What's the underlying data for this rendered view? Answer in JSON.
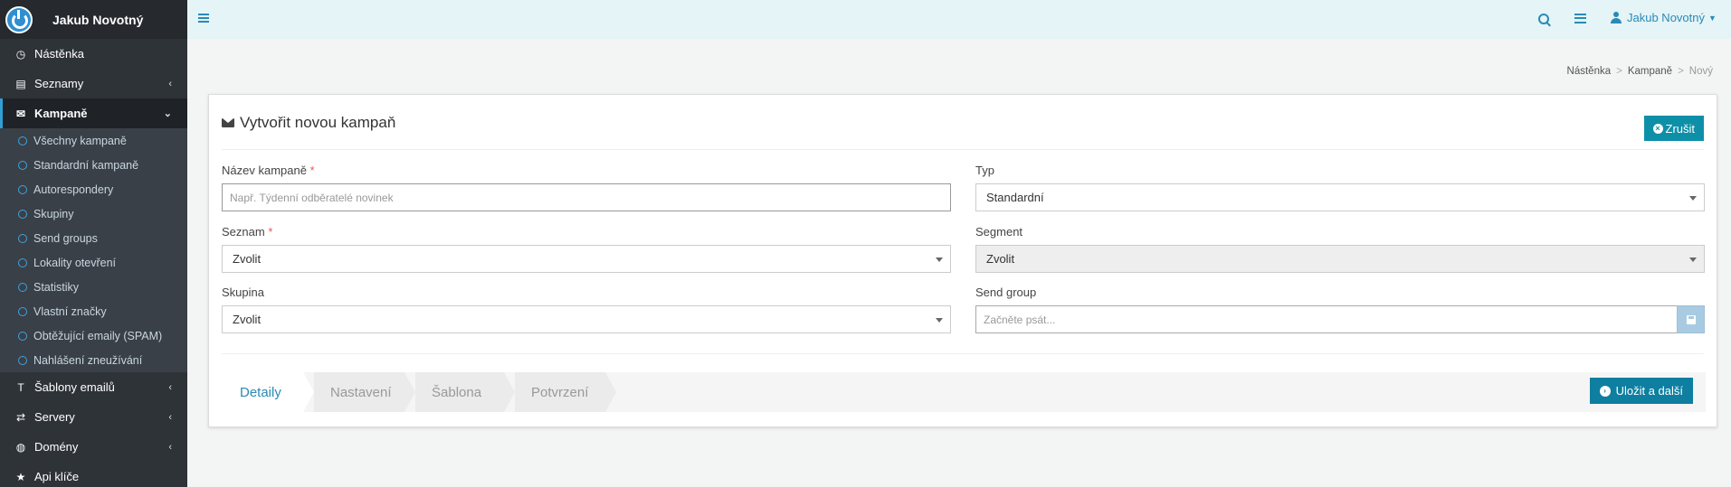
{
  "brand": {
    "name": "Jakub Novotný"
  },
  "sidebar": {
    "items": [
      {
        "label": "Nástěnka",
        "icon": "dashboard-icon"
      },
      {
        "label": "Seznamy",
        "icon": "list-icon"
      },
      {
        "label": "Kampaně",
        "icon": "envelope-icon"
      },
      {
        "label": "Šablony emailů",
        "icon": "text-icon"
      },
      {
        "label": "Servery",
        "icon": "exchange-icon"
      },
      {
        "label": "Domény",
        "icon": "globe-icon"
      },
      {
        "label": "Api klíče",
        "icon": "star-icon"
      }
    ],
    "sub_items": [
      "Všechny kampaně",
      "Standardní kampaně",
      "Autorespondery",
      "Skupiny",
      "Send groups",
      "Lokality otevření",
      "Statistiky",
      "Vlastní značky",
      "Obtěžující emaily (SPAM)",
      "Nahlášení zneužívání"
    ]
  },
  "topbar": {
    "user": "Jakub Novotný"
  },
  "breadcrumb": {
    "home": "Nástěnka",
    "section": "Kampaně",
    "current": "Nový"
  },
  "panel": {
    "title": "Vytvořit novou kampaň",
    "cancel_label": "Zrušit"
  },
  "form": {
    "name_label": "Název kampaně",
    "name_placeholder": "Např. Týdenní odběratelé novinek",
    "required_mark": "*",
    "type_label": "Typ",
    "type_value": "Standardní",
    "list_label": "Seznam",
    "list_value": "Zvolit",
    "segment_label": "Segment",
    "segment_value": "Zvolit",
    "group_label": "Skupina",
    "group_value": "Zvolit",
    "send_group_label": "Send group",
    "send_group_placeholder": "Začněte psát..."
  },
  "wizard": {
    "steps": [
      "Detaily",
      "Nastavení",
      "Šablona",
      "Potvrzení"
    ],
    "active_step": 0,
    "next_label": "Uložit a další"
  },
  "colors": {
    "accent": "#0e8fa8",
    "sidebar": "#2e3338",
    "topbar": "#e4f4f7"
  }
}
